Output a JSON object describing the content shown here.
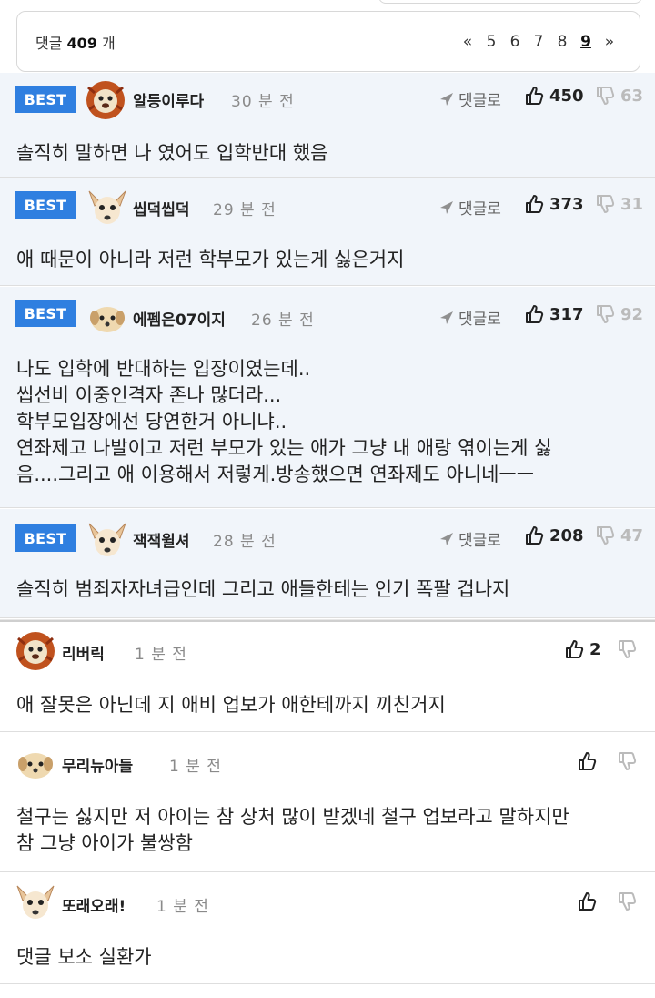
{
  "header": {
    "count_prefix": "댓글",
    "count_value": "409",
    "count_suffix": "개",
    "pager": {
      "prev": "«",
      "pages": [
        "5",
        "6",
        "7",
        "8",
        "9"
      ],
      "current": "9",
      "next": "»"
    }
  },
  "comments": [
    {
      "best": true,
      "badge": "BEST",
      "nickname": "알등이루다",
      "time": "30 분 전",
      "reply_label": "댓글로",
      "likes": "450",
      "dislikes": "63",
      "text": "솔직히 말하면 나 였어도 입학반대 했음"
    },
    {
      "best": true,
      "badge": "BEST",
      "nickname": "씹덕씹덕",
      "time": "29 분 전",
      "reply_label": "댓글로",
      "likes": "373",
      "dislikes": "31",
      "text": "애 때문이 아니라 저런 학부모가 있는게 싫은거지"
    },
    {
      "best": true,
      "badge": "BEST",
      "nickname": "에펨은07이지",
      "time": "26 분 전",
      "reply_label": "댓글로",
      "likes": "317",
      "dislikes": "92",
      "text": "나도 입학에 반대하는 입장이였는데..\n씹선비 이중인격자 존나 많더라...\n학부모입장에선 당연한거 아니냐..\n연좌제고 나발이고 저런 부모가 있는 애가 그냥 내 애랑 엮이는게 싫\n음....그리고 애 이용해서 저렇게.방송했으면 연좌제도 아니네ㅡㅡ"
    },
    {
      "best": true,
      "badge": "BEST",
      "nickname": "잭잭윌셔",
      "time": "28 분 전",
      "reply_label": "댓글로",
      "likes": "208",
      "dislikes": "47",
      "text": "솔직히 범죄자자녀급인데 그리고 애들한테는 인기 폭팔 겁나지"
    },
    {
      "best": false,
      "nickname": "리버릭",
      "time": "1 분 전",
      "likes": "2",
      "dislikes": "",
      "text": "애 잘못은 아닌데 지 애비 업보가 애한테까지 끼친거지"
    },
    {
      "best": false,
      "nickname": "무리뉴아들",
      "time": "1 분 전",
      "likes": "",
      "dislikes": "",
      "text": "철구는 싫지만 저 아이는 참 상처 많이 받겠네 철구 업보라고 말하지만\n참 그냥 아이가 불쌍함"
    },
    {
      "best": false,
      "nickname": "또래오래!",
      "time": "1 분 전",
      "likes": "",
      "dislikes": "",
      "text": "댓글 보소 실환가"
    }
  ],
  "colors": {
    "best_badge": "#2f7fe0",
    "best_background": "#f1f5fa",
    "time_text": "#8a8a8a",
    "dislike_icon": "#bbbbbb"
  },
  "icons": {
    "reply": "reply-arrow-icon",
    "like": "thumbs-up-icon",
    "dislike": "thumbs-down-icon",
    "avatar_lion": "lion-avatar-icon",
    "avatar_chihuahua": "chihuahua-avatar-icon",
    "avatar_puppy": "puppy-avatar-icon"
  }
}
